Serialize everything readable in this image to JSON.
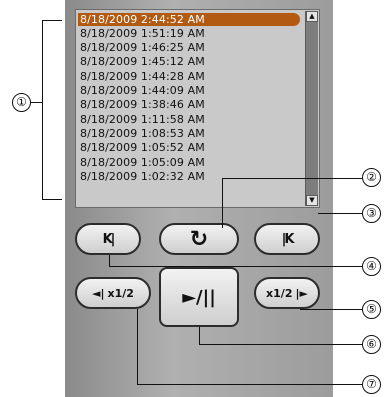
{
  "timestamps": [
    "8/18/2009 2:44:52 AM",
    "8/18/2009 1:51:19 AM",
    "8/18/2009 1:46:25 AM",
    "8/18/2009 1:45:12 AM",
    "8/18/2009 1:44:28 AM",
    "8/18/2009 1:44:09 AM",
    "8/18/2009 1:38:46 AM",
    "8/18/2009 1:11:58 AM",
    "8/18/2009 1:08:53 AM",
    "8/18/2009 1:05:52 AM",
    "8/18/2009 1:05:09 AM",
    "8/18/2009 1:02:32 AM"
  ],
  "selected_index": 0,
  "buttons": {
    "prev": "K|",
    "replay": "↻",
    "next": "|K",
    "slow_reverse": "x1/2",
    "play_pause": "►/||",
    "slow_forward": "x1/2"
  },
  "callouts": [
    "①",
    "②",
    "③",
    "④",
    "⑤",
    "⑥",
    "⑦"
  ],
  "colors": {
    "selected": "#b25a12",
    "list_bg": "#c9c9c9",
    "panel": "#a3a3a3"
  }
}
